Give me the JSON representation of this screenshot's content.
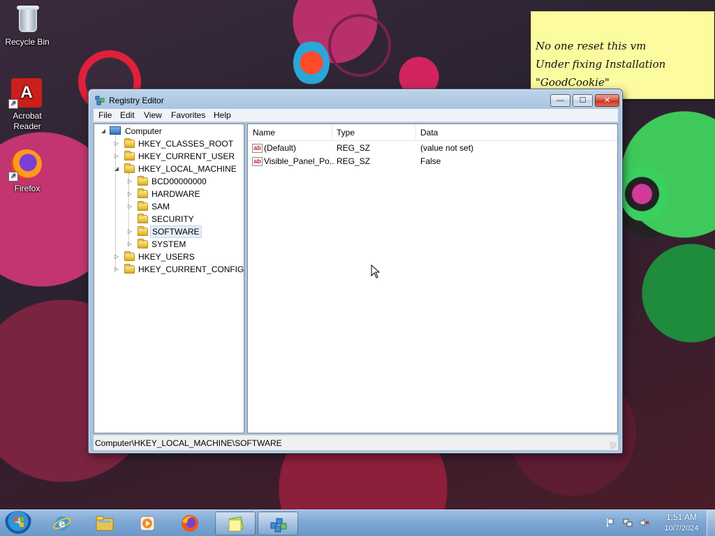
{
  "desktop": {
    "icons": [
      {
        "label": "Recycle Bin",
        "icon": "recycle-bin-icon"
      },
      {
        "label": "Acrobat Reader",
        "icon": "acrobat-reader-icon"
      },
      {
        "label": "Firefox",
        "icon": "firefox-icon"
      }
    ],
    "sticky_note": {
      "lines": [
        "No one reset this vm",
        "Under fixing Installation",
        "\"GoodCookie\""
      ],
      "color": "#fdfba0"
    }
  },
  "window": {
    "title": "Registry Editor",
    "icon": "registry-editor-icon",
    "caption_buttons": {
      "minimize": "—",
      "maximize": "☐",
      "close": "✕"
    },
    "menu": [
      "File",
      "Edit",
      "View",
      "Favorites",
      "Help"
    ],
    "tree": {
      "root": "Computer",
      "hives": [
        {
          "label": "HKEY_CLASSES_ROOT",
          "expanded": false
        },
        {
          "label": "HKEY_CURRENT_USER",
          "expanded": false
        },
        {
          "label": "HKEY_LOCAL_MACHINE",
          "expanded": true,
          "children": [
            "BCD00000000",
            "HARDWARE",
            "SAM",
            "SECURITY",
            "SOFTWARE",
            "SYSTEM"
          ],
          "selected_child": "SOFTWARE"
        },
        {
          "label": "HKEY_USERS",
          "expanded": false
        },
        {
          "label": "HKEY_CURRENT_CONFIG",
          "expanded": false
        }
      ]
    },
    "list": {
      "columns": [
        "Name",
        "Type",
        "Data"
      ],
      "rows": [
        {
          "name": "(Default)",
          "type": "REG_SZ",
          "data": "(value not set)"
        },
        {
          "name": "Visible_Panel_Po...",
          "type": "REG_SZ",
          "data": "False"
        }
      ]
    },
    "status": "Computer\\HKEY_LOCAL_MACHINE\\SOFTWARE"
  },
  "taskbar": {
    "start_icon": "windows-start-icon",
    "pinned": [
      {
        "name": "internet-explorer",
        "icon": "internet-explorer-icon"
      },
      {
        "name": "windows-explorer",
        "icon": "folder-icon"
      },
      {
        "name": "media-player",
        "icon": "media-player-icon"
      },
      {
        "name": "firefox",
        "icon": "firefox-icon"
      },
      {
        "name": "sticky-notes",
        "icon": "sticky-notes-icon"
      },
      {
        "name": "registry-editor",
        "icon": "registry-editor-icon"
      }
    ],
    "tray_icons": [
      "flag-icon",
      "network-icon",
      "volume-muted-icon"
    ],
    "clock": {
      "time": "1:51 AM",
      "date": "10/7/2024"
    }
  }
}
